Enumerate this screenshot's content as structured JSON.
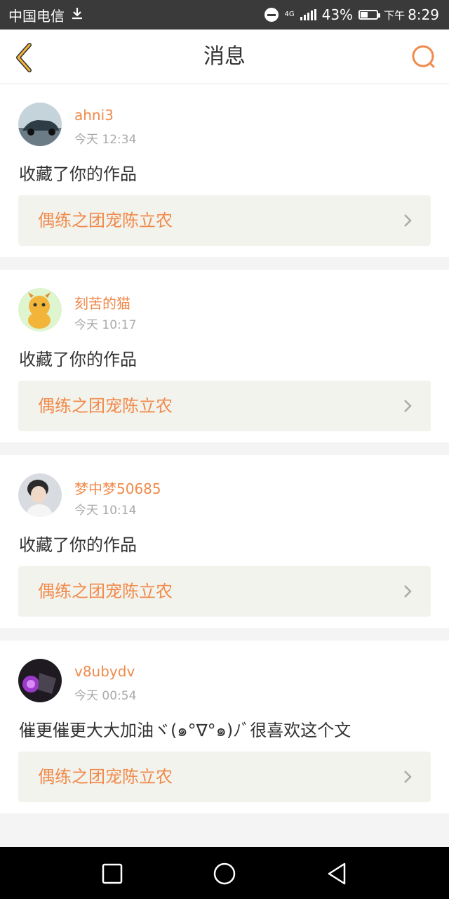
{
  "status_bar": {
    "carrier": "中国电信",
    "network": "4G",
    "battery": "43%",
    "ampm": "下午",
    "time": "8:29"
  },
  "header": {
    "title": "消息"
  },
  "messages": [
    {
      "username": "ahni3",
      "time": "今天 12:34",
      "text": "收藏了你的作品",
      "work_title": "偶练之团宠陈立农",
      "avatar_colors": [
        "#4a6e85",
        "#c5d3db"
      ]
    },
    {
      "username": "刻苦的猫",
      "time": "今天 10:17",
      "text": "收藏了你的作品",
      "work_title": "偶练之团宠陈立农",
      "avatar_colors": [
        "#f2b53a",
        "#dff5cf"
      ]
    },
    {
      "username": "梦中梦50685",
      "time": "今天 10:14",
      "text": "收藏了你的作品",
      "work_title": "偶练之团宠陈立农",
      "avatar_colors": [
        "#2b2b2b",
        "#d8dbe0"
      ]
    },
    {
      "username": "v8ubydv",
      "time": "今天 00:54",
      "text": "催更催更大大加油ヾ(๑°∇°๑)ﾉﾞ很喜欢这个文",
      "work_title": "偶练之团宠陈立农",
      "avatar_colors": [
        "#1f1a22",
        "#9b39c8"
      ]
    }
  ],
  "colors": {
    "accent": "#f08a4b",
    "back_arrow": "#f2b53a",
    "status_bar_bg": "#3a3a3a"
  }
}
